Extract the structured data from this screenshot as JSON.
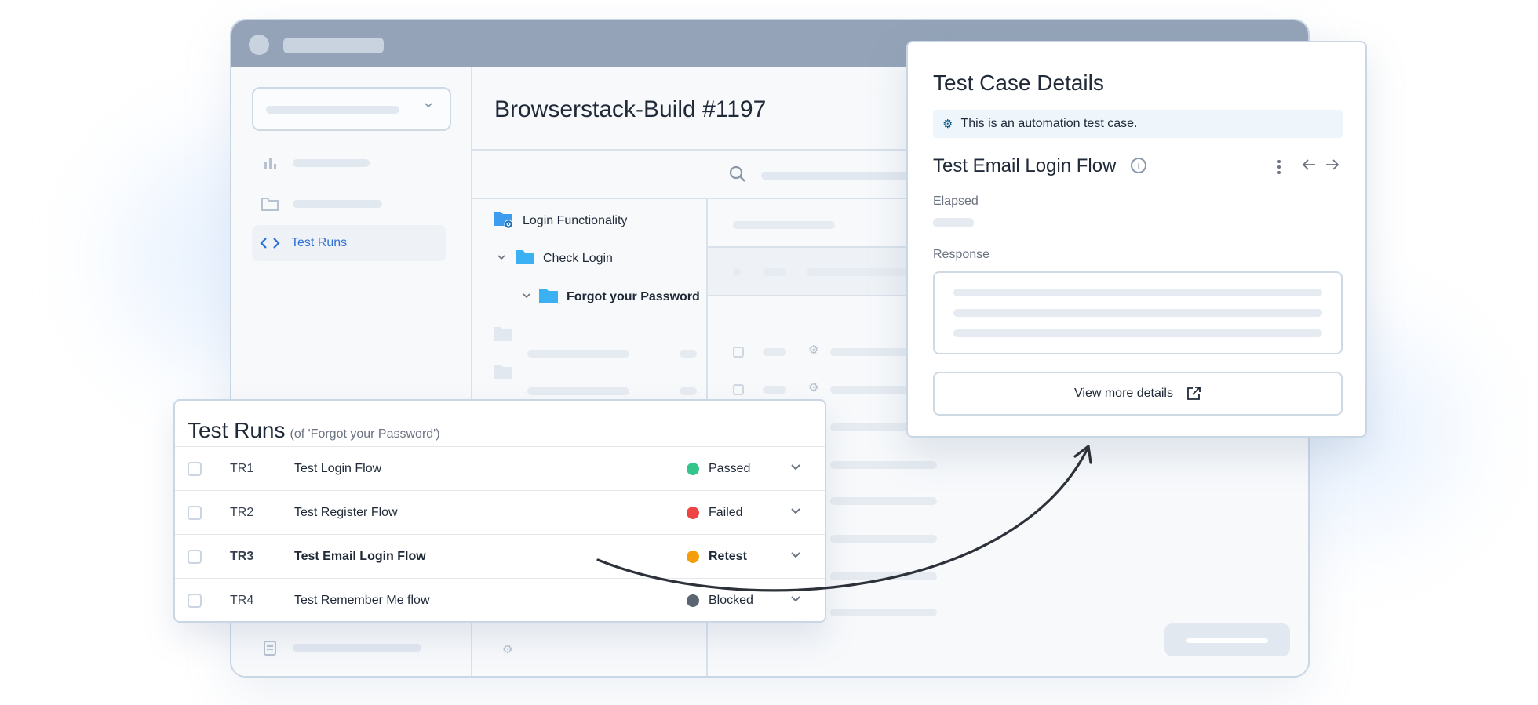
{
  "build": {
    "title": "Browserstack-Build #1197"
  },
  "sidebar": {
    "active_item": {
      "label": "Test Runs",
      "icon": "code-icon"
    }
  },
  "tree": {
    "items": [
      {
        "label": "Login Functionality",
        "icon": "folder-gear-icon"
      },
      {
        "label": "Check Login",
        "icon": "folder-icon"
      },
      {
        "label": "Forgot your Password",
        "icon": "folder-icon"
      }
    ]
  },
  "runs_panel": {
    "title": "Test Runs",
    "subtitle": "(of 'Forgot your Password')",
    "rows": [
      {
        "id": "TR1",
        "name": "Test Login Flow",
        "status": "Passed",
        "status_color": "#34c58c"
      },
      {
        "id": "TR2",
        "name": "Test Register Flow",
        "status": "Failed",
        "status_color": "#ef4444"
      },
      {
        "id": "TR3",
        "name": "Test Email Login Flow",
        "status": "Retest",
        "status_color": "#f59e0b"
      },
      {
        "id": "TR4",
        "name": "Test Remember Me flow",
        "status": "Blocked",
        "status_color": "#5b6572"
      }
    ]
  },
  "details_panel": {
    "title": "Test Case Details",
    "banner": "This is an automation test case.",
    "case_title": "Test Email Login Flow",
    "elapsed_label": "Elapsed",
    "response_label": "Response",
    "view_more_label": "View more details"
  },
  "colors": {
    "accent": "#2b6fd6",
    "titlebar": "#94a3b8"
  }
}
